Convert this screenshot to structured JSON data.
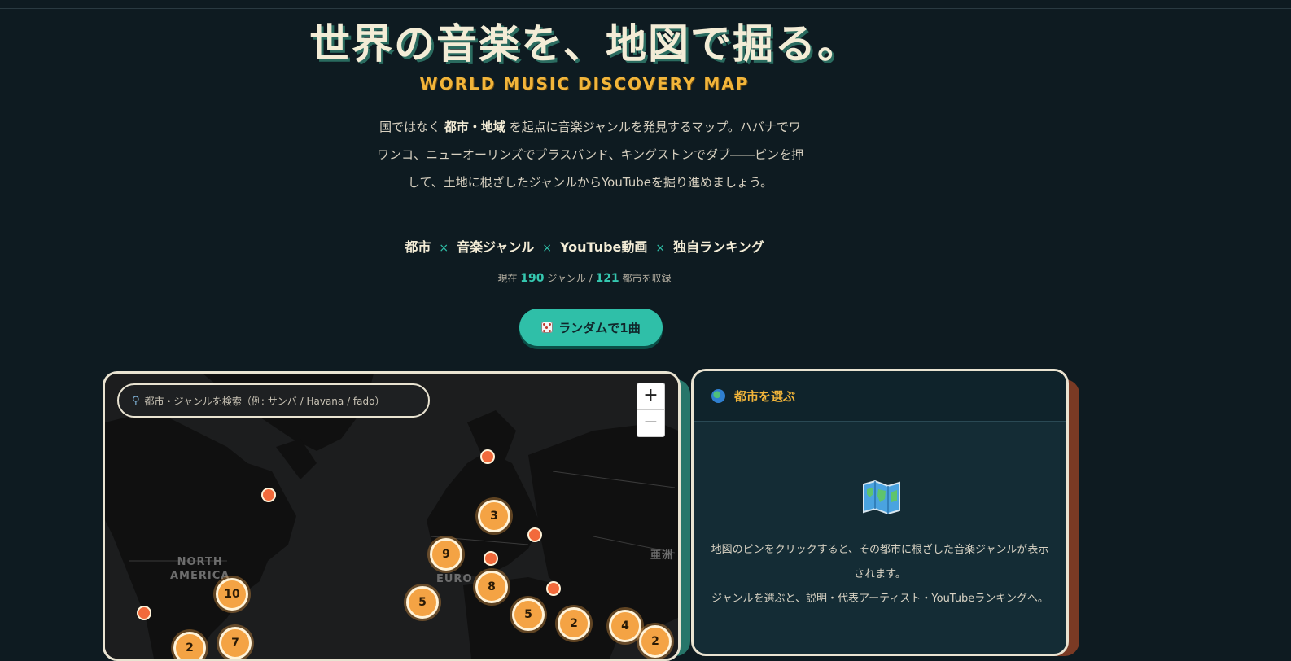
{
  "hero": {
    "title": "世界の音楽を、地図で掘る。",
    "subtitle": "WORLD MUSIC DISCOVERY MAP",
    "lead": {
      "before": "国ではなく ",
      "emphasis": "都市・地域",
      "after": " を起点に音楽ジャンルを発見するマップ。ハバナでワワンコ、ニューオーリンズでブラスバンド、キングストンでダブ――ピンを押して、土地に根ざしたジャンルからYouTubeを掘り進めましょう。"
    },
    "features": [
      "都市",
      "音楽ジャンル",
      "YouTube動画",
      "独自ランキング"
    ],
    "feature_separator": "×",
    "count": {
      "prefix": "現在",
      "genres": "190",
      "genres_label": "ジャンル /",
      "cities": "121",
      "cities_label": "都市を収録"
    },
    "random_button": "ランダムで1曲"
  },
  "map": {
    "search_placeholder": "都市・ジャンルを検索（例: サンバ / Havana / fado）",
    "zoom_in": "+",
    "zoom_out": "−",
    "labels": {
      "north_america_line1": "NORTH",
      "north_america_line2": "AMERICA",
      "europe": "EURO",
      "asia": "亜洲"
    },
    "clusters": [
      "3",
      "9",
      "8",
      "10",
      "5",
      "5",
      "2",
      "4",
      "2",
      "7",
      "2"
    ],
    "accent_colors": {
      "cluster": "#f4a344",
      "pin": "#f26a3b"
    }
  },
  "panel": {
    "title": "都市を選ぶ",
    "text1": "地図のピンをクリックすると、その都市に根ざした音楽ジャンルが表示されます。",
    "text2": "ジャンルを選ぶと、説明・代表アーティスト・YouTubeランキングへ。"
  },
  "colors": {
    "teal": "#2fbfa8",
    "gold": "#f2b53a",
    "background": "#0e1b21"
  }
}
